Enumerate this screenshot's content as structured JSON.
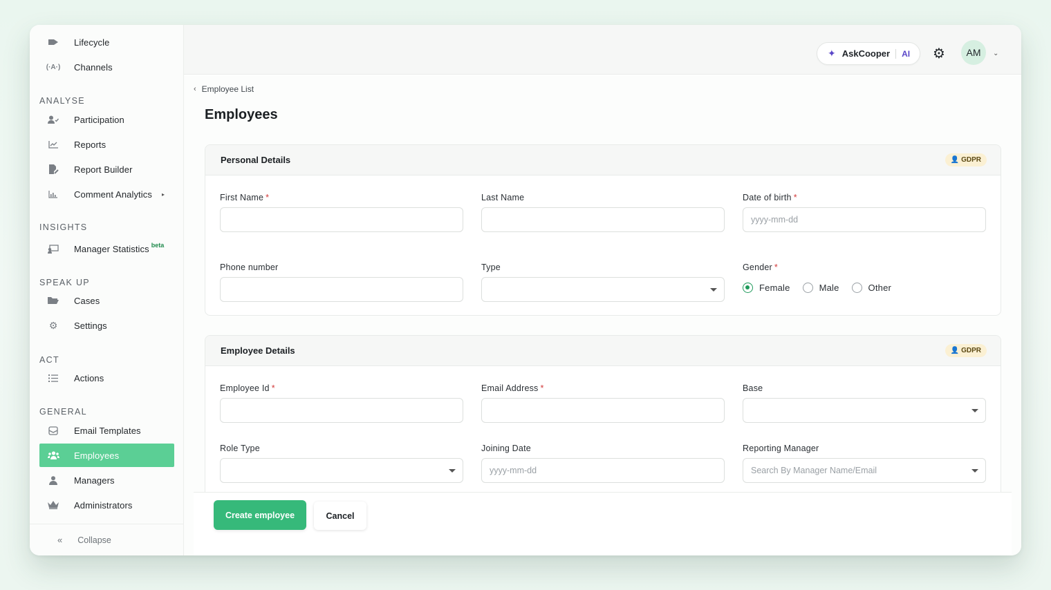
{
  "sidebar": {
    "top_items": [
      {
        "label": "Lifecycle",
        "icon": "lifecycle-icon"
      },
      {
        "label": "Channels",
        "icon": "broadcast-icon"
      }
    ],
    "sections": [
      {
        "title": "ANALYSE",
        "items": [
          {
            "label": "Participation",
            "icon": "user-check-icon"
          },
          {
            "label": "Reports",
            "icon": "line-chart-icon"
          },
          {
            "label": "Report Builder",
            "icon": "file-edit-icon"
          },
          {
            "label": "Comment Analytics",
            "icon": "bar-chart-icon"
          }
        ]
      },
      {
        "title": "INSIGHTS",
        "items": [
          {
            "label": "Manager Statistics",
            "icon": "presentation-icon",
            "badge": "beta"
          }
        ]
      },
      {
        "title": "SPEAK UP",
        "items": [
          {
            "label": "Cases",
            "icon": "folder-open-icon"
          },
          {
            "label": "Settings",
            "icon": "gear-icon"
          }
        ]
      },
      {
        "title": "ACT",
        "items": [
          {
            "label": "Actions",
            "icon": "list-icon"
          }
        ]
      },
      {
        "title": "GENERAL",
        "items": [
          {
            "label": "Email Templates",
            "icon": "mail-template-icon"
          },
          {
            "label": "Employees",
            "icon": "users-icon",
            "active": true
          },
          {
            "label": "Managers",
            "icon": "user-icon"
          },
          {
            "label": "Administrators",
            "icon": "crown-icon"
          }
        ]
      }
    ],
    "collapse_label": "Collapse"
  },
  "topbar": {
    "ask_name": "AskCooper",
    "ask_badge": "AI",
    "avatar_initials": "AM"
  },
  "breadcrumb": "Employee List",
  "page_title": "Employees",
  "personal": {
    "title": "Personal Details",
    "gdpr": "GDPR",
    "first_name": "First Name",
    "last_name": "Last Name",
    "dob": "Date of birth",
    "dob_placeholder": "yyyy-mm-dd",
    "phone": "Phone number",
    "type": "Type",
    "gender": "Gender",
    "gender_options": [
      "Female",
      "Male",
      "Other"
    ],
    "gender_selected": "Female"
  },
  "employee": {
    "title": "Employee Details",
    "gdpr": "GDPR",
    "employee_id": "Employee Id",
    "email": "Email Address",
    "base": "Base",
    "role_type": "Role Type",
    "joining_date": "Joining Date",
    "joining_placeholder": "yyyy-mm-dd",
    "reporting_manager": "Reporting Manager",
    "reporting_placeholder": "Search By Manager Name/Email"
  },
  "actions": {
    "create": "Create employee",
    "cancel": "Cancel"
  },
  "colors": {
    "accent": "#36b97a",
    "active_nav": "#5bcf95",
    "ai_purple": "#5a46c8",
    "required": "#d23b3b"
  }
}
